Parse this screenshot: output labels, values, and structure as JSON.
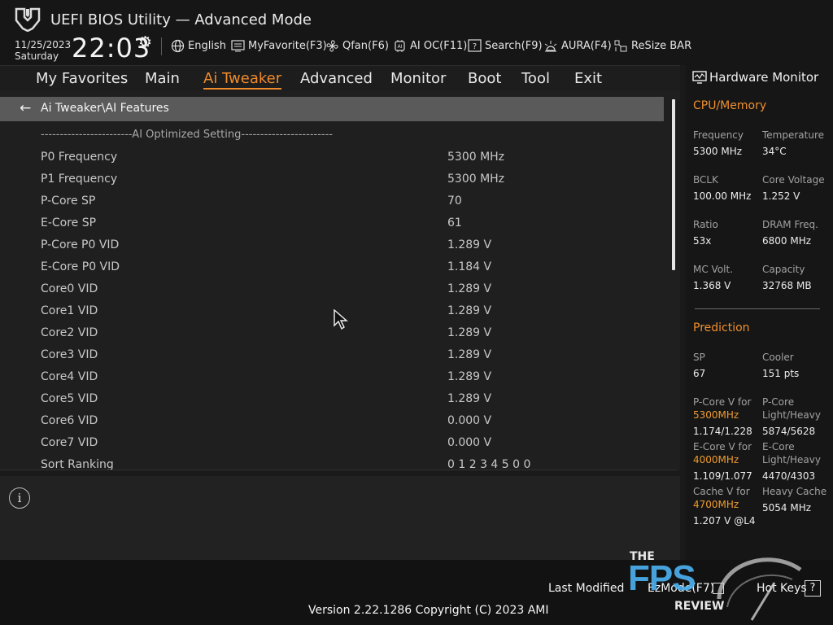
{
  "header": {
    "title": "UEFI BIOS Utility — Advanced Mode",
    "date": "11/25/2023",
    "day": "Saturday",
    "time": "22:03",
    "tools": [
      {
        "label": "English",
        "icon": "globe-icon"
      },
      {
        "label": "MyFavorite(F3)",
        "icon": "favorite-icon"
      },
      {
        "label": "Qfan(F6)",
        "icon": "fan-icon"
      },
      {
        "label": "AI OC(F11)",
        "icon": "ai-chip-icon"
      },
      {
        "label": "Search(F9)",
        "icon": "search-help-icon"
      },
      {
        "label": "AURA(F4)",
        "icon": "aura-light-icon"
      },
      {
        "label": "ReSize BAR",
        "icon": "resize-bar-icon"
      }
    ]
  },
  "menu": {
    "items": [
      "My Favorites",
      "Main",
      "Ai Tweaker",
      "Advanced",
      "Monitor",
      "Boot",
      "Tool",
      "Exit"
    ],
    "active": "Ai Tweaker"
  },
  "content": {
    "breadcrumb": "Ai Tweaker\\AI Features",
    "section": "------------------------AI Optimized Setting------------------------",
    "rows": [
      {
        "label": "P0 Frequency",
        "value": "5300 MHz"
      },
      {
        "label": "P1 Frequency",
        "value": "5300 MHz"
      },
      {
        "label": "P-Core SP",
        "value": "70"
      },
      {
        "label": "E-Core SP",
        "value": "61"
      },
      {
        "label": "P-Core P0 VID",
        "value": "1.289 V"
      },
      {
        "label": "E-Core P0 VID",
        "value": "1.184 V"
      },
      {
        "label": "Core0 VID",
        "value": "1.289 V"
      },
      {
        "label": "Core1 VID",
        "value": "1.289 V"
      },
      {
        "label": "Core2 VID",
        "value": "1.289 V"
      },
      {
        "label": "Core3 VID",
        "value": "1.289 V"
      },
      {
        "label": "Core4 VID",
        "value": "1.289 V"
      },
      {
        "label": "Core5 VID",
        "value": "1.289 V"
      },
      {
        "label": "Core6 VID",
        "value": "0.000 V"
      },
      {
        "label": "Core7 VID",
        "value": "0.000 V"
      },
      {
        "label": "Sort Ranking",
        "value": "0 1 2 3 4 5 0 0"
      }
    ]
  },
  "hardware_monitor": {
    "title": "Hardware Monitor",
    "cpu_section": "CPU/Memory",
    "cpu": [
      {
        "label": "Frequency",
        "value": "5300 MHz"
      },
      {
        "label": "Temperature",
        "value": "34°C"
      },
      {
        "label": "BCLK",
        "value": "100.00 MHz"
      },
      {
        "label": "Core Voltage",
        "value": "1.252 V"
      },
      {
        "label": "Ratio",
        "value": "53x"
      },
      {
        "label": "DRAM Freq.",
        "value": "6800 MHz"
      },
      {
        "label": "MC Volt.",
        "value": "1.368 V"
      },
      {
        "label": "Capacity",
        "value": "32768 MB"
      }
    ],
    "prediction_section": "Prediction",
    "sp_label": "SP",
    "sp_value": "67",
    "cooler_label": "Cooler",
    "cooler_value": "151 pts",
    "pcore_label": "P-Core V for",
    "pcore_freq": "5300MHz",
    "pcore_value": "1.174/1.228",
    "pcore_lh_label1": "P-Core",
    "pcore_lh_label2": "Light/Heavy",
    "pcore_lh_value": "5874/5628",
    "ecore_label": "E-Core V for",
    "ecore_freq": "4000MHz",
    "ecore_value": "1.109/1.077",
    "ecore_lh_label1": "E-Core",
    "ecore_lh_label2": "Light/Heavy",
    "ecore_lh_value": "4470/4303",
    "cache_label": "Cache V for",
    "cache_freq": "4700MHz",
    "cache_value": "1.207 V @L4",
    "heavy_cache_label": "Heavy Cache",
    "heavy_cache_value": "5054 MHz"
  },
  "footer": {
    "last_modified": "Last Modified",
    "ezmode": "EzMode(F7)",
    "hot_keys": "Hot Keys",
    "hot_keys_key": "?",
    "version": "Version 2.22.1286 Copyright (C) 2023 AMI"
  },
  "watermark": {
    "the": "THE",
    "fps": "FPS",
    "review": "REVIEW"
  },
  "colors": {
    "accent": "#f08a2b",
    "hw_section": "#ef8f2f",
    "breadcrumb_bg": "#5a5a5a",
    "watermark_blue": "#4db2f2"
  }
}
